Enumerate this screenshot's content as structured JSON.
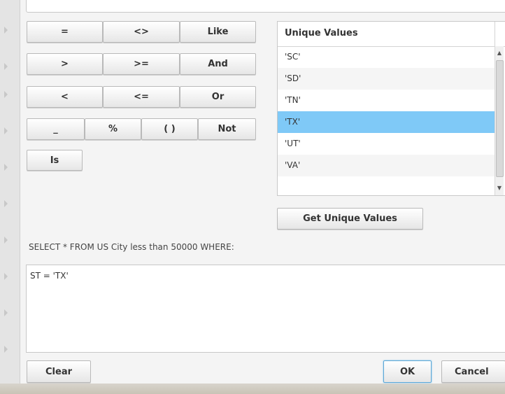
{
  "operators": {
    "row1": [
      "=",
      "<>",
      "Like"
    ],
    "row2": [
      ">",
      ">=",
      "And"
    ],
    "row3": [
      "<",
      "<=",
      "Or"
    ],
    "row4": [
      "_",
      "%",
      "( )",
      "Not"
    ],
    "is": "Is"
  },
  "unique_values": {
    "header": "Unique Values",
    "items": [
      "'SC'",
      "'SD'",
      "'TN'",
      "'TX'",
      "'UT'",
      "'VA'"
    ],
    "selected": "'TX'",
    "get_button": "Get Unique Values"
  },
  "query": {
    "prefix": "SELECT * FROM US City less than 50000 WHERE:",
    "where_text": "ST = 'TX'"
  },
  "footer": {
    "clear": "Clear",
    "ok": "OK",
    "cancel": "Cancel"
  },
  "colors": {
    "selected_row": "#7fc9f7",
    "ok_border": "#5aa7d6"
  }
}
